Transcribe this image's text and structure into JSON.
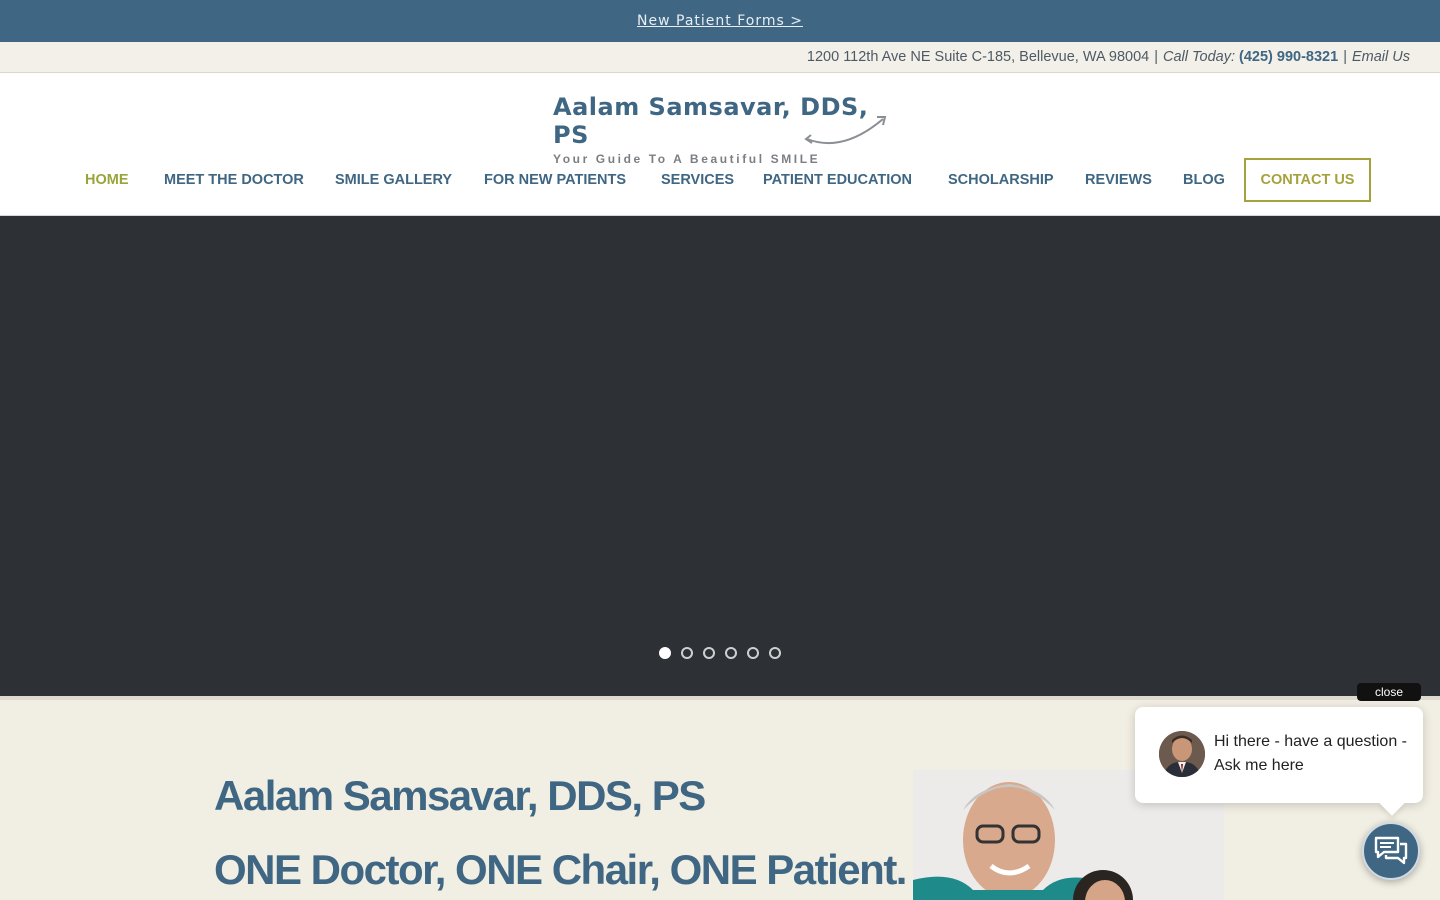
{
  "topbar": {
    "link": "New Patient Forms >"
  },
  "infobar": {
    "address": "1200 112th Ave NE Suite C-185, Bellevue, WA 98004",
    "sep1": "|",
    "call_label": "Call Today:",
    "phone": "(425) 990-8321",
    "sep2": "|",
    "email": "Email Us"
  },
  "logo": {
    "title": "Aalam Samsavar, DDS, PS",
    "tagline": "Your Guide To A Beautiful SMILE"
  },
  "nav": {
    "items": [
      "HOME",
      "MEET THE DOCTOR",
      "SMILE GALLERY",
      "FOR NEW PATIENTS",
      "SERVICES",
      "PATIENT EDUCATION",
      "SCHOLARSHIP",
      "REVIEWS",
      "BLOG"
    ],
    "contact": "CONTACT US",
    "active": "HOME"
  },
  "hero": {
    "slide_count": 6,
    "active_slide": 1
  },
  "content": {
    "title": "Aalam Samsavar, DDS, PS",
    "motto": "ONE Doctor, ONE Chair, ONE Patient."
  },
  "chat": {
    "close": "close",
    "message": "Hi there - have a question - Ask me here"
  },
  "colors": {
    "brand_blue": "#3f6683",
    "accent_olive": "#a5a23d",
    "hero_bg": "#2d3136"
  }
}
